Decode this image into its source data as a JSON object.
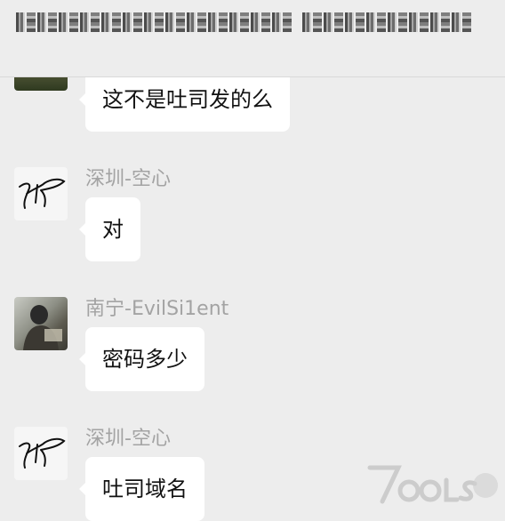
{
  "header": {
    "title_obscured": true
  },
  "messages": [
    {
      "sender": "",
      "avatar": "photo-avatar-partial",
      "text": "这不是吐司发的么"
    },
    {
      "sender": "深圳-空心",
      "avatar": "signature-avatar",
      "text": "对"
    },
    {
      "sender": "南宁-EvilSi1ent",
      "avatar": "photo-avatar",
      "text": "密码多少"
    },
    {
      "sender": "深圳-空心",
      "avatar": "signature-avatar",
      "text": "吐司域名"
    }
  ],
  "watermark": {
    "text": "TOOLS"
  },
  "colors": {
    "background": "#ededed",
    "bubble": "#ffffff",
    "sender": "#a3a3a3",
    "text": "#111111"
  }
}
